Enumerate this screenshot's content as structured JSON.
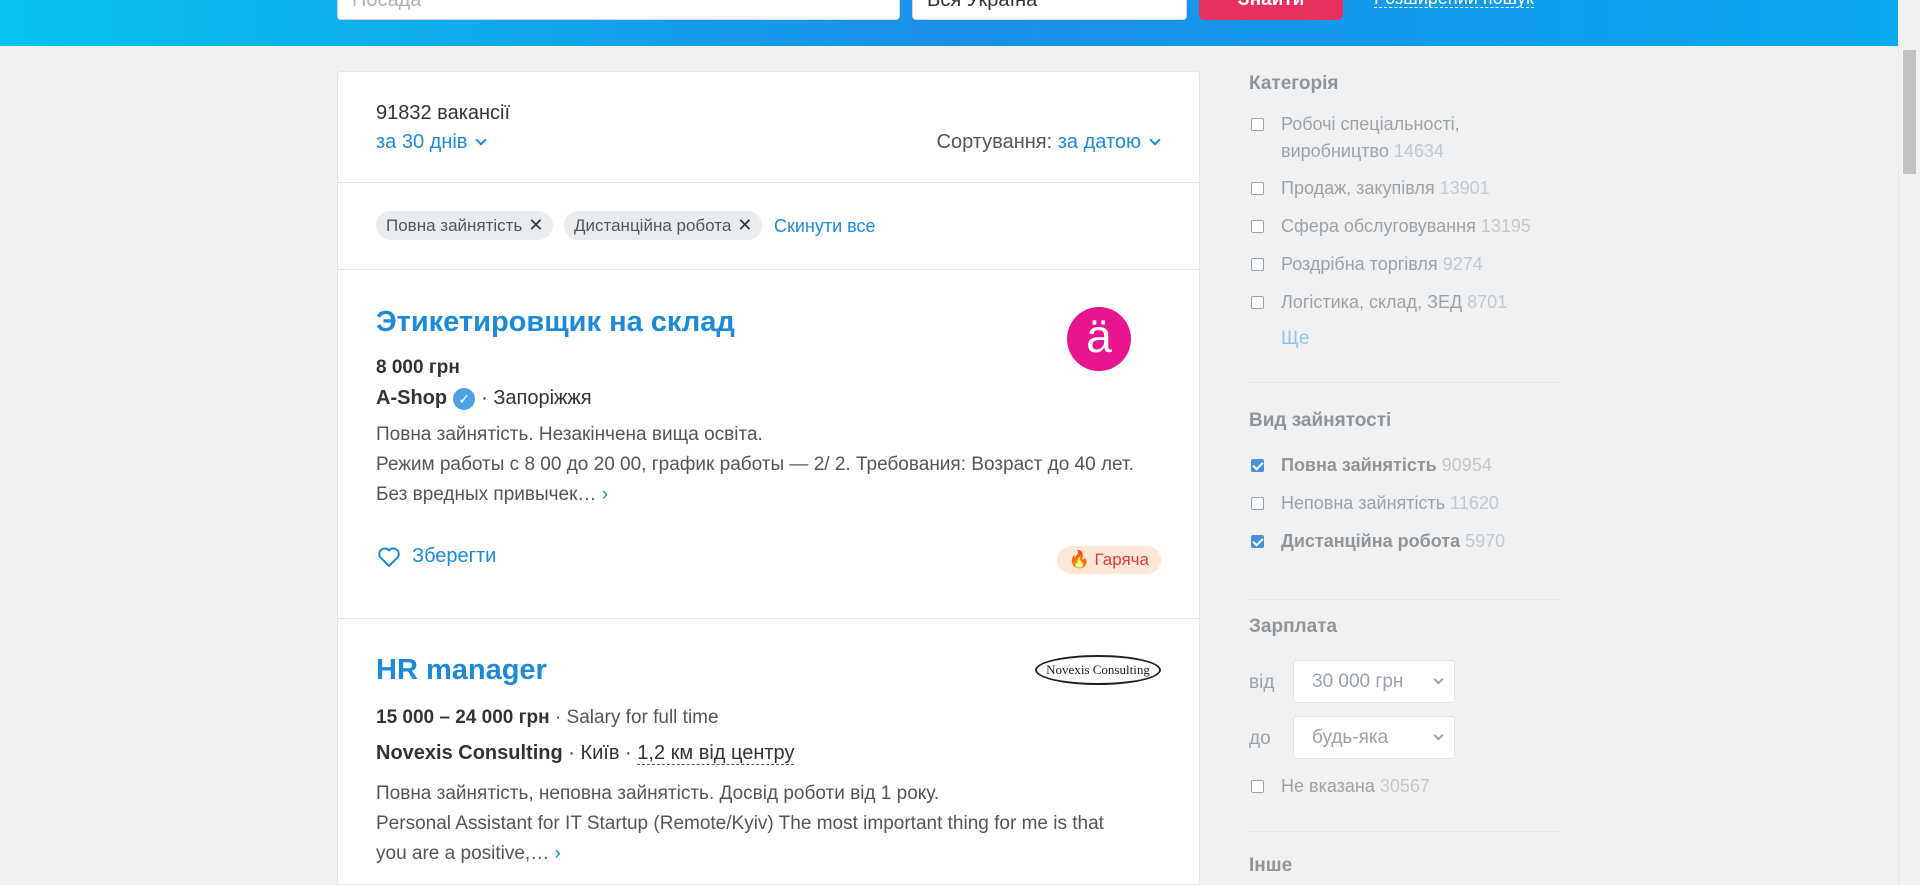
{
  "header": {
    "search_placeholder": "Посада",
    "location_value": "Вся Україна",
    "search_button": "Знайти",
    "advanced_link": "Розширений пошук"
  },
  "results": {
    "count": "91832 вакансії",
    "period": "за 30 днів",
    "sort_label": "Сортування:",
    "sort_value": "за датою"
  },
  "active_filters": {
    "chips": [
      "Повна зайнятість",
      "Дистанційна робота"
    ],
    "reset": "Скинути все"
  },
  "vacancies": [
    {
      "title": "Этикетировщик на склад",
      "salary": "8 000 грн",
      "company": "A-Shop",
      "city": "Запоріжжя",
      "desc1": "Повна зайнятість. Незакінчена вища освіта.",
      "desc2": "Режим работы с 8 00 до 20 00, график работы — 2/ 2. Требования: Возраст до 40 лет. Без вредных привычек…",
      "save": "Зберегти",
      "badge": "Гаряча",
      "logo_text": "ä"
    },
    {
      "title": "HR manager",
      "salary": "15 000 – 24 000 грн",
      "salary_note": "Salary for full time",
      "company": "Novexis Consulting",
      "city": "Київ",
      "distance": "1,2 км від центру",
      "desc1": "Повна зайнятість, неповна зайнятість. Досвід роботи від 1 року.",
      "desc2": "Personal Assistant for IT Startup (Remote/Kyiv) The most important thing for me is that you are a positive,…",
      "logo_text": "Novexis Consulting"
    }
  ],
  "sidebar": {
    "category": {
      "title": "Категорія",
      "items": [
        {
          "label": "Робочі спеціальності, виробництво",
          "count": "14634"
        },
        {
          "label": "Продаж, закупівля",
          "count": "13901"
        },
        {
          "label": "Сфера обслуговування",
          "count": "13195"
        },
        {
          "label": "Роздрібна торгівля",
          "count": "9274"
        },
        {
          "label": "Логістика, склад, ЗЕД",
          "count": "8701"
        }
      ],
      "more": "Ще"
    },
    "employment": {
      "title": "Вид зайнятості",
      "items": [
        {
          "label": "Повна зайнятість",
          "count": "90954",
          "checked": true
        },
        {
          "label": "Неповна зайнятість",
          "count": "11620",
          "checked": false
        },
        {
          "label": "Дистанційна робота",
          "count": "5970",
          "checked": true
        }
      ]
    },
    "salary": {
      "title": "Зарплата",
      "from_label": "від",
      "from_value": "30 000 грн",
      "to_label": "до",
      "to_value": "будь-яка",
      "unspecified_label": "Не вказана",
      "unspecified_count": "30567"
    },
    "other": {
      "title": "Інше"
    }
  }
}
